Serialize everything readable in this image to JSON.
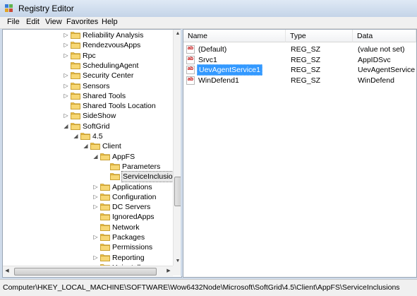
{
  "window": {
    "title": "Registry Editor"
  },
  "menu": [
    "File",
    "Edit",
    "View",
    "Favorites",
    "Help"
  ],
  "tree": [
    {
      "label": "Reliability Analysis",
      "level": 0,
      "expander": "collapsed"
    },
    {
      "label": "RendezvousApps",
      "level": 0,
      "expander": "collapsed"
    },
    {
      "label": "Rpc",
      "level": 0,
      "expander": "collapsed"
    },
    {
      "label": "SchedulingAgent",
      "level": 0,
      "expander": "none"
    },
    {
      "label": "Security Center",
      "level": 0,
      "expander": "collapsed"
    },
    {
      "label": "Sensors",
      "level": 0,
      "expander": "collapsed"
    },
    {
      "label": "Shared Tools",
      "level": 0,
      "expander": "collapsed"
    },
    {
      "label": "Shared Tools Location",
      "level": 0,
      "expander": "none"
    },
    {
      "label": "SideShow",
      "level": 0,
      "expander": "collapsed"
    },
    {
      "label": "SoftGrid",
      "level": 0,
      "expander": "expanded"
    },
    {
      "label": "4.5",
      "level": 1,
      "expander": "expanded"
    },
    {
      "label": "Client",
      "level": 2,
      "expander": "expanded"
    },
    {
      "label": "AppFS",
      "level": 3,
      "expander": "expanded"
    },
    {
      "label": "Parameters",
      "level": 4,
      "expander": "none"
    },
    {
      "label": "ServiceInclusions",
      "level": 4,
      "expander": "none",
      "selected": true
    },
    {
      "label": "Applications",
      "level": 3,
      "expander": "collapsed"
    },
    {
      "label": "Configuration",
      "level": 3,
      "expander": "collapsed"
    },
    {
      "label": "DC Servers",
      "level": 3,
      "expander": "collapsed"
    },
    {
      "label": "IgnoredApps",
      "level": 3,
      "expander": "none"
    },
    {
      "label": "Network",
      "level": 3,
      "expander": "none"
    },
    {
      "label": "Packages",
      "level": 3,
      "expander": "collapsed"
    },
    {
      "label": "Permissions",
      "level": 3,
      "expander": "none"
    },
    {
      "label": "Reporting",
      "level": 3,
      "expander": "collapsed"
    },
    {
      "label": "Uninstall",
      "level": 3,
      "expander": "collapsed"
    }
  ],
  "columns": {
    "name": "Name",
    "type": "Type",
    "data": "Data"
  },
  "values": [
    {
      "name": "(Default)",
      "type": "REG_SZ",
      "data": "(value not set)"
    },
    {
      "name": "Srvc1",
      "type": "REG_SZ",
      "data": "AppIDSvc"
    },
    {
      "name": "UevAgentService1",
      "type": "REG_SZ",
      "data": "UevAgentService",
      "selected": true
    },
    {
      "name": "WinDefend1",
      "type": "REG_SZ",
      "data": "WinDefend"
    }
  ],
  "value_icon_text": "ab",
  "status": {
    "path": "Computer\\HKEY_LOCAL_MACHINE\\SOFTWARE\\Wow6432Node\\Microsoft\\SoftGrid\\4.5\\Client\\AppFS\\ServiceInclusions"
  },
  "colors": {
    "selection": "#3399ff",
    "folder": "#f0c14b"
  }
}
